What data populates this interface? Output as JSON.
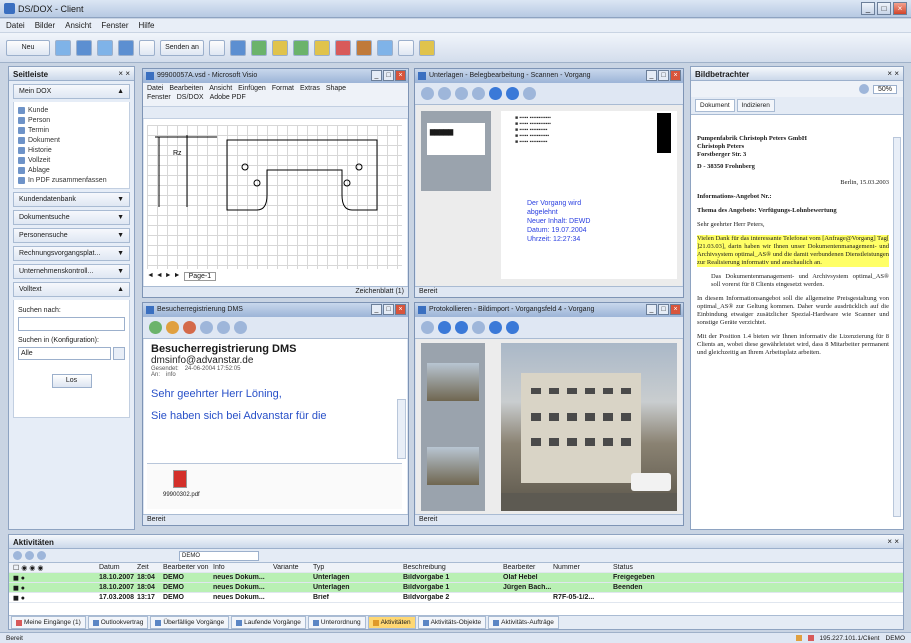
{
  "app": {
    "title": "DS/DOX - Client"
  },
  "menu": [
    "Datei",
    "Bilder",
    "Ansicht",
    "Fenster",
    "Hilfe"
  ],
  "toolbar": {
    "new_label": "Neu",
    "send_label": "Senden an"
  },
  "sidebar": {
    "title": "Seitleiste",
    "sections": [
      {
        "label": "Mein DOX",
        "items": [
          "Kunde",
          "Person",
          "Termin",
          "Dokument",
          "Historie",
          "Vollzeit",
          "Ablage",
          "In PDF zusammenfassen"
        ]
      },
      {
        "label": "Kundendatenbank"
      },
      {
        "label": "Dokumentsuche"
      },
      {
        "label": "Personensuche"
      },
      {
        "label": "Rechnungsvorgangsplat..."
      },
      {
        "label": "Unternehmenskontroll..."
      },
      {
        "label": "Volltext"
      }
    ],
    "search": {
      "label": "Suchen nach:",
      "label2": "Suchen in (Konfiguration):",
      "scope": "Alle",
      "button": "Los"
    }
  },
  "visio": {
    "title": "99900057A.vsd - Microsoft Visio",
    "menu": [
      "Datei",
      "Bearbeiten",
      "Ansicht",
      "Einfügen",
      "Format",
      "Extras",
      "Shape",
      "Fenster",
      "?"
    ],
    "submenu": [
      "Fenster",
      "DS/DOX",
      "Adobe PDF"
    ],
    "page_tab": "Page-1",
    "zoom_label": "Zeichenblatt (1)"
  },
  "viewer1": {
    "title": "Unterlagen - Belegbearbeitung - Scannen - Vorgang",
    "stamp": [
      "Der Vorgang wird",
      "abgelehnt",
      "Neuer Inhalt: DEWD",
      "Datum: 19.07.2004",
      "Uhrzeit: 12:27:34"
    ],
    "status": "Bereit"
  },
  "email": {
    "title": "Besucherregistrierung DMS",
    "heading": "Besucherregistrierung DMS",
    "from": "dmsinfo@advanstar.de",
    "sent_label": "Gesendet:",
    "sent": "24-06-2004 17:52:05",
    "to_label": "An:",
    "to": "info",
    "greeting": "Sehr geehrter Herr Löning,",
    "body": "Sie haben sich bei Advanstar für die",
    "attachment": "99900302.pdf",
    "status": "Bereit"
  },
  "viewer2": {
    "title": "Protokollieren - Bildimport - Vorgangsfeld 4 - Vorgang",
    "status": "Bereit"
  },
  "preview": {
    "title": "Bildbetrachter",
    "zoom": "50%",
    "tab1": "Dokument",
    "tab2": "Indizieren",
    "address": [
      "Pumpenfabrik Christoph Peters GmbH",
      "Christoph Peters",
      "Forstberger Str. 3",
      "D - 38350 Frohnberg"
    ],
    "date": "Berlin, 15.03.2003",
    "subject1": "Informations-Angebot Nr.:",
    "subject2": "Thema des Angebots: Verfügungs-Lohnbewertung",
    "salutation": "Sehr geehrter Herr Peters,",
    "p1": "Vielen Dank für das interessante Telefonat vom [Anfrage@Vorgang] Tag[ ]21.03.03], darin haben wir Ihnen unser Dokumentenmanagement- und Archivsystem optimal_AS® und die damit verbundenen Dienstleistungen zur Realisierung informativ und anschaulich an.",
    "bullet": "Das Dokumentenmanagement- und Archivsystem optimal_AS® soll vorerst für 8 Clients eingesetzt werden.",
    "p2": "In diesem Informationsangebot soll die allgemeine Preisgestaltung von optimal_AS® zur Geltung kommen. Daher wurde ausdrücklich auf die Einbindung etwaiger zusätzlicher Spezial-Hardware wie Scanner und sonstige Geräte verzichtet.",
    "p3": "Mit der Position 1.4 bieten wir Ihnen informativ die Lizenzierung für 8 Clients an, wobei diese gewährleistet wird, dass 8 Mitarbeiter permanent und gleichzeitig an Ihrem Arbeitsplatz arbeiten."
  },
  "activities": {
    "title": "Aktivitäten",
    "filter": "DEMO",
    "columns": [
      "Datum",
      "Zeit",
      "Bearbeiter von",
      "Info",
      "Variante",
      "Typ",
      "Beschreibung",
      "Bearbeiter",
      "Nummer",
      "Status"
    ],
    "rows": [
      [
        "18.10.2007",
        "18:04",
        "DEMO",
        "neues Dokum...",
        "",
        "Unterlagen",
        "Bildvorgabe 1",
        "Olaf Hebel",
        "",
        "Freigegeben"
      ],
      [
        "18.10.2007",
        "18:04",
        "DEMO",
        "neues Dokum...",
        "",
        "Unterlagen",
        "Bildvorgabe 1",
        "Jürgen Bach...",
        "",
        "Beenden"
      ],
      [
        "17.03.2008",
        "13:17",
        "DEMO",
        "neues Dokum...",
        "",
        "Brief",
        "Bildvorgabe 2",
        "",
        "R7F-05-1/2...",
        ""
      ]
    ],
    "tabs": [
      "Meine Eingänge (1)",
      "Outlookvertrag",
      "Überfällige Vorgänge",
      "Laufende Vorgänge",
      "Unterordnung",
      "Aktivitäten",
      "Aktivitäts-Objekte",
      "Aktivitäts-Aufträge"
    ]
  },
  "statusbar": {
    "left": "Bereit",
    "ip": "195.227.101.1/Client",
    "user": "DEMO"
  }
}
